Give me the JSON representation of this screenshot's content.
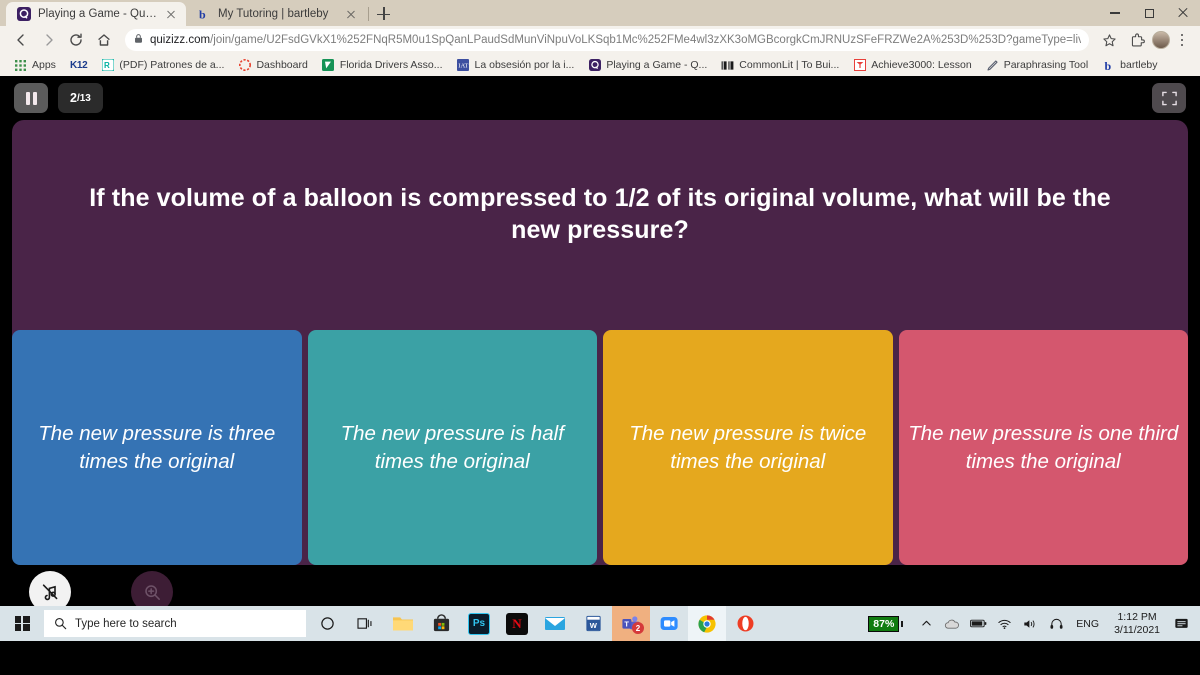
{
  "browser": {
    "tabs": [
      {
        "title": "Playing a Game - Quizizz",
        "favicon": "quizizz-icon",
        "active": true
      },
      {
        "title": "My Tutoring | bartleby",
        "favicon": "bartleby-icon",
        "active": false
      }
    ],
    "new_tab_label": "+",
    "window_controls": {
      "minimize": "minimize-icon",
      "maximize": "maximize-icon",
      "close": "close-icon"
    },
    "nav": {
      "back": "back-arrow-icon",
      "forward": "forward-arrow-icon",
      "reload": "reload-icon",
      "home": "home-icon"
    },
    "address": {
      "lock": "lock-icon",
      "host": "quizizz.com",
      "path": "/join/game/U2FsdGVkX1%252FNqR5M0u1SpQanLPaudSdMunViNpuVoLKSqb1Mc%252FMe4wl3zXK3oMGBcorgkCmJRNUzSFeFRZWe2A%253D%253D?gameType=live"
    },
    "actions": {
      "bookmark": "star-icon",
      "extensions": "extensions-icon",
      "profile": "avatar",
      "menu": "three-dot-menu-icon"
    },
    "bookmarks": [
      {
        "label": "Apps",
        "icon": "apps-grid-icon"
      },
      {
        "label": "K12",
        "icon": "k12-icon"
      },
      {
        "label": "(PDF) Patrones de a...",
        "icon": "researchgate-icon"
      },
      {
        "label": "Dashboard",
        "icon": "dashboard-icon"
      },
      {
        "label": "Florida Drivers Asso...",
        "icon": "florida-drivers-icon"
      },
      {
        "label": "La obsesión por la i...",
        "icon": "iat-icon"
      },
      {
        "label": "Playing a Game - Q...",
        "icon": "quizizz-icon"
      },
      {
        "label": "CommonLit | To Bui...",
        "icon": "commonlit-icon"
      },
      {
        "label": "Achieve3000: Lesson",
        "icon": "achieve3000-icon"
      },
      {
        "label": "Paraphrasing Tool",
        "icon": "paraphrasing-icon"
      },
      {
        "label": "bartleby",
        "icon": "bartleby-icon"
      }
    ]
  },
  "quiz": {
    "pause_label": "pause-icon",
    "counter_current": "2",
    "counter_separator": "/",
    "counter_total": "13",
    "fullscreen_label": "fullscreen-icon",
    "question": "If the volume of a balloon is compressed to 1/2 of its original volume, what will be the new pressure?",
    "card_background": "#4a2448",
    "answers": [
      {
        "text": "The new pressure is three times the original",
        "color": "#3573b4"
      },
      {
        "text": "The new pressure is half times the original",
        "color": "#3ba1a5"
      },
      {
        "text": "The new pressure is twice times the original",
        "color": "#e5a81e"
      },
      {
        "text": "The new pressure is one third times the original",
        "color": "#d4576e"
      }
    ],
    "controls": [
      {
        "label": "Music off",
        "icon": "music-muted-icon",
        "state": "enabled"
      },
      {
        "label": "Zoom In",
        "icon": "zoom-in-icon",
        "state": "disabled"
      }
    ]
  },
  "taskbar": {
    "start": "windows-logo-icon",
    "search_placeholder": "Type here to search",
    "search_icon": "search-icon",
    "items": [
      {
        "name": "cortana-icon",
        "glyph": "O",
        "bg": "transparent",
        "fg": "#1b1b1b"
      },
      {
        "name": "task-view-icon",
        "glyph": "❏",
        "bg": "transparent",
        "fg": "#1b1b1b"
      },
      {
        "name": "file-explorer-icon",
        "glyph": "",
        "bg": "#f4b63f",
        "fg": "#fff"
      },
      {
        "name": "microsoft-store-icon",
        "glyph": "",
        "bg": "#2b2b2b",
        "fg": "#fff"
      },
      {
        "name": "photoshop-icon",
        "glyph": "Ps",
        "bg": "#0a1c2b",
        "fg": "#31c5f0"
      },
      {
        "name": "netflix-icon",
        "glyph": "N",
        "bg": "#0b0b0b",
        "fg": "#e50914"
      },
      {
        "name": "mail-icon",
        "glyph": "",
        "bg": "#2aa5e0",
        "fg": "#fff"
      },
      {
        "name": "word-icon",
        "glyph": "W",
        "bg": "#2b579a",
        "fg": "#fff"
      },
      {
        "name": "teams-icon",
        "glyph": "T",
        "bg": "#5b5fc7",
        "fg": "#fff",
        "badge": "2"
      },
      {
        "name": "zoom-icon",
        "glyph": "",
        "bg": "#2d8cff",
        "fg": "#fff"
      },
      {
        "name": "chrome-icon",
        "glyph": "",
        "bg": "transparent",
        "fg": "#fff"
      },
      {
        "name": "opera-icon",
        "glyph": "O",
        "bg": "transparent",
        "fg": "#ee3d24"
      }
    ],
    "tray": {
      "battery_percent": "87%",
      "chevron": "show-hidden-icons-icon",
      "onedrive": "onedrive-icon",
      "battery": "battery-icon",
      "wifi": "wifi-icon",
      "volume": "volume-icon",
      "bluetooth_audio": "headphones-icon",
      "language": "ENG",
      "time": "1:12 PM",
      "date": "3/11/2021",
      "notifications": "notification-center-icon"
    }
  }
}
